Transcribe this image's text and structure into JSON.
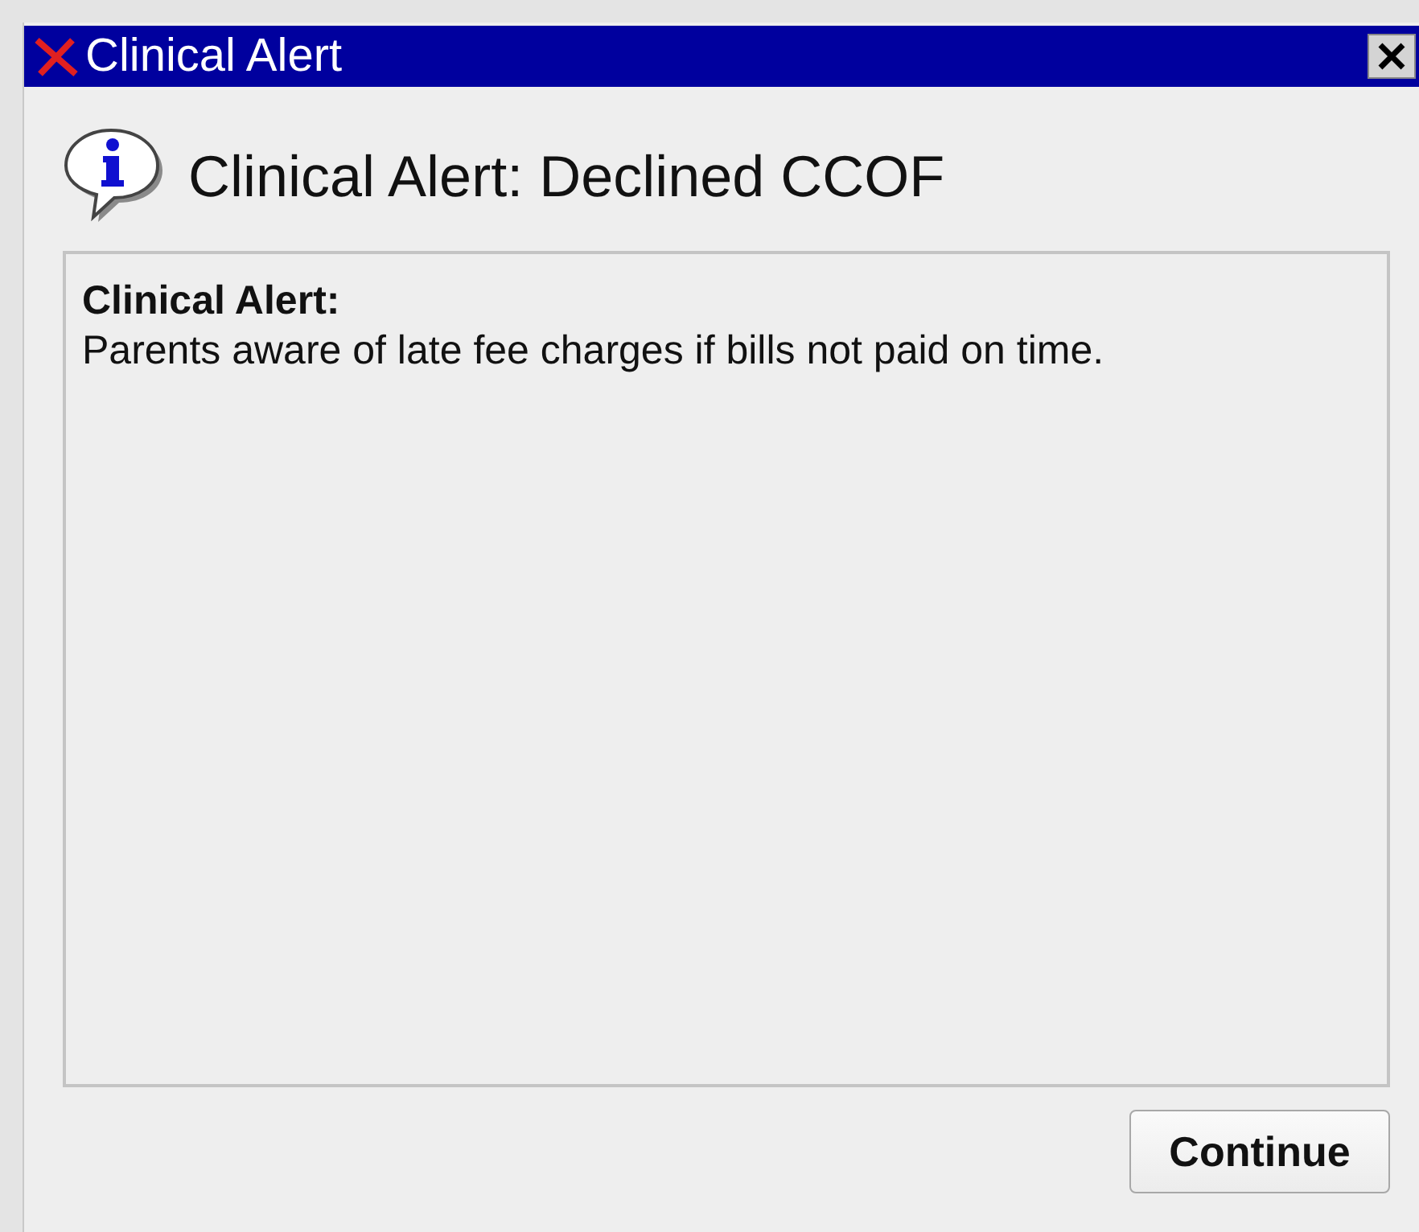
{
  "window": {
    "title": "Clinical Alert"
  },
  "heading": "Clinical Alert: Declined CCOF",
  "message": {
    "label": "Clinical Alert:",
    "text": "Parents aware of late fee charges if bills not paid on time."
  },
  "buttons": [
    "Continue"
  ]
}
